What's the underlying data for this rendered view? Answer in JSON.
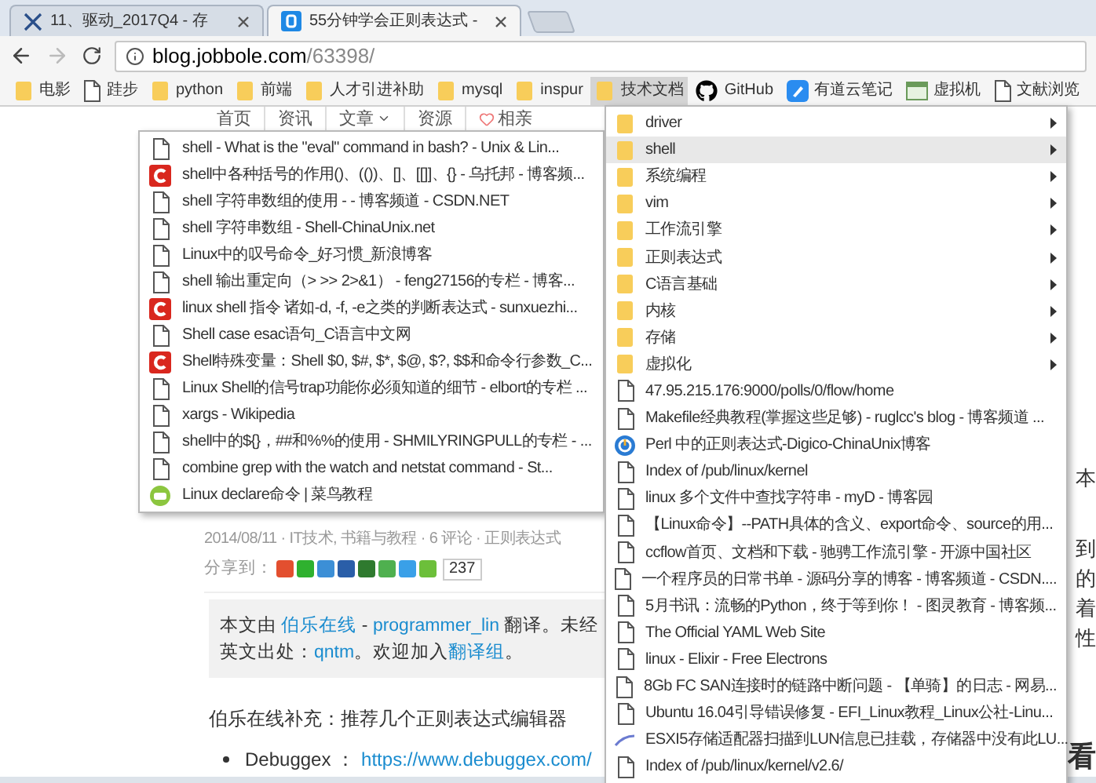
{
  "tabs": [
    {
      "title": "11、驱动_2017Q4 - 存",
      "selected": false
    },
    {
      "title": "55分钟学会正则表达式 -",
      "selected": true
    }
  ],
  "address": {
    "host": "blog.jobbole.com",
    "path": "/63398/"
  },
  "bookmarks": [
    {
      "label": "电影",
      "kind": "folder",
      "selected": false
    },
    {
      "label": "跬步",
      "kind": "page",
      "selected": false
    },
    {
      "label": "python",
      "kind": "folder",
      "selected": false
    },
    {
      "label": "前端",
      "kind": "folder",
      "selected": false
    },
    {
      "label": "人才引进补助",
      "kind": "folder",
      "selected": false
    },
    {
      "label": "mysql",
      "kind": "folder",
      "selected": false
    },
    {
      "label": "inspur",
      "kind": "folder",
      "selected": false
    },
    {
      "label": "技术文档",
      "kind": "folder",
      "selected": true
    },
    {
      "label": "GitHub",
      "kind": "cat",
      "selected": false
    },
    {
      "label": "有道云笔记",
      "kind": "note",
      "selected": false
    },
    {
      "label": "虚拟机",
      "kind": "vm",
      "selected": false
    },
    {
      "label": "文献浏览",
      "kind": "page",
      "selected": false
    }
  ],
  "page": {
    "nav": [
      {
        "label": "首页",
        "kind": "plain"
      },
      {
        "label": "资讯",
        "kind": "plain"
      },
      {
        "label": "文章",
        "kind": "dropdown"
      },
      {
        "label": "资源",
        "kind": "plain"
      },
      {
        "label": "相亲",
        "kind": "heart"
      }
    ],
    "meta": "2014/08/11 · IT技术, 书籍与教程 · 6 评论 · 正则表达式",
    "share_label": "分享到：",
    "share_count": "237",
    "quote_lines": [
      [
        {
          "text": "本文由 ",
          "link": false
        },
        {
          "text": "伯乐在线",
          "link": true
        },
        {
          "text": " - ",
          "link": false
        },
        {
          "text": "programmer_lin",
          "link": true
        },
        {
          "text": " 翻译。未经",
          "link": false
        }
      ],
      [
        {
          "text": "英文出处：",
          "link": false
        },
        {
          "text": "qntm",
          "link": true
        },
        {
          "text": "。欢迎加入",
          "link": false
        },
        {
          "text": "翻译组",
          "link": true
        },
        {
          "text": "。",
          "link": false
        }
      ]
    ],
    "paragraph": "伯乐在线补充：推荐几个正则表达式编辑器",
    "bullet": {
      "name": "Debuggex ：",
      "url": "https://www.debuggex.com/"
    },
    "side_fragments": [
      "本",
      "到",
      "的",
      "着",
      "性",
      "看"
    ]
  },
  "folder_menu": [
    {
      "label": "driver",
      "kind": "folder",
      "selected": false
    },
    {
      "label": "shell",
      "kind": "folder",
      "selected": true
    },
    {
      "label": "系统编程",
      "kind": "folder",
      "selected": false
    },
    {
      "label": "vim",
      "kind": "folder",
      "selected": false
    },
    {
      "label": "工作流引擎",
      "kind": "folder",
      "selected": false
    },
    {
      "label": "正则表达式",
      "kind": "folder",
      "selected": false
    },
    {
      "label": "C语言基础",
      "kind": "folder",
      "selected": false
    },
    {
      "label": "内核",
      "kind": "folder",
      "selected": false
    },
    {
      "label": "存储",
      "kind": "folder",
      "selected": false
    },
    {
      "label": "虚拟化",
      "kind": "folder",
      "selected": false
    },
    {
      "label": "47.95.215.176:9000/polls/0/flow/home",
      "kind": "page",
      "selected": false
    },
    {
      "label": "Makefile经典教程(掌握这些足够) - ruglcc's blog - 博客频道 ...",
      "kind": "page",
      "selected": false
    },
    {
      "label": "Perl 中的正则表达式-Digico-ChinaUnix博客",
      "kind": "globe",
      "selected": false
    },
    {
      "label": "Index of /pub/linux/kernel",
      "kind": "page",
      "selected": false
    },
    {
      "label": "linux 多个文件中查找字符串 - myD - 博客园",
      "kind": "page",
      "selected": false
    },
    {
      "label": "【Linux命令】--PATH具体的含义、export命令、source的用...",
      "kind": "page",
      "selected": false
    },
    {
      "label": "ccflow首页、文档和下载 - 驰骋工作流引擎 - 开源中国社区",
      "kind": "page",
      "selected": false
    },
    {
      "label": "一个程序员的日常书单 - 源码分享的博客 - 博客频道 - CSDN....",
      "kind": "page",
      "selected": false
    },
    {
      "label": "5月书讯：流畅的Python，终于等到你！ - 图灵教育 - 博客频...",
      "kind": "page",
      "selected": false
    },
    {
      "label": "The Official YAML Web Site",
      "kind": "page",
      "selected": false
    },
    {
      "label": "linux - Elixir - Free Electrons",
      "kind": "page",
      "selected": false
    },
    {
      "label": "8Gb FC SAN连接时的链路中断问题 - 【单骑】的日志 - 网易...",
      "kind": "page",
      "selected": false
    },
    {
      "label": "Ubuntu 16.04引导错误修复 - EFI_Linux教程_Linux公社-Linu...",
      "kind": "page",
      "selected": false
    },
    {
      "label": "ESXI5存储适配器扫描到LUN信息已挂载，存储器中没有此LU...",
      "kind": "swoosh",
      "selected": false
    },
    {
      "label": "Index of /pub/linux/kernel/v2.6/",
      "kind": "page",
      "selected": false
    }
  ],
  "shell_menu": [
    {
      "label": "shell - What is the \"eval\" command in bash? - Unix & Lin...",
      "kind": "page"
    },
    {
      "label": "shell中各种括号的作用()、(())、[]、[[]]、{} - 乌托邦 - 博客频...",
      "kind": "red-c"
    },
    {
      "label": "shell 字符串数组的使用 - - 博客频道 - CSDN.NET",
      "kind": "page"
    },
    {
      "label": "shell 字符串数组 - Shell-ChinaUnix.net",
      "kind": "page"
    },
    {
      "label": "Linux中的叹号命令_好习惯_新浪博客",
      "kind": "page"
    },
    {
      "label": "shell 输出重定向（> >> 2>&1） - feng27156的专栏 - 博客...",
      "kind": "page"
    },
    {
      "label": "linux shell 指令 诸如-d, -f, -e之类的判断表达式 - sunxuezhi...",
      "kind": "red-c"
    },
    {
      "label": "Shell case esac语句_C语言中文网",
      "kind": "page"
    },
    {
      "label": "Shell特殊变量：Shell $0, $#, $*, $@, $?, $$和命令行参数_C...",
      "kind": "red-c"
    },
    {
      "label": "Linux Shell的信号trap功能你必须知道的细节 - elbort的专栏 ...",
      "kind": "page"
    },
    {
      "label": "xargs - Wikipedia",
      "kind": "page"
    },
    {
      "label": "shell中的${}，##和%%的使用 - SHMILYRINGPULL的专栏 - ...",
      "kind": "page"
    },
    {
      "label": "combine grep with the watch and netstat command - St...",
      "kind": "page"
    },
    {
      "label": "Linux declare命令 | 菜鸟教程",
      "kind": "green-badge"
    }
  ]
}
